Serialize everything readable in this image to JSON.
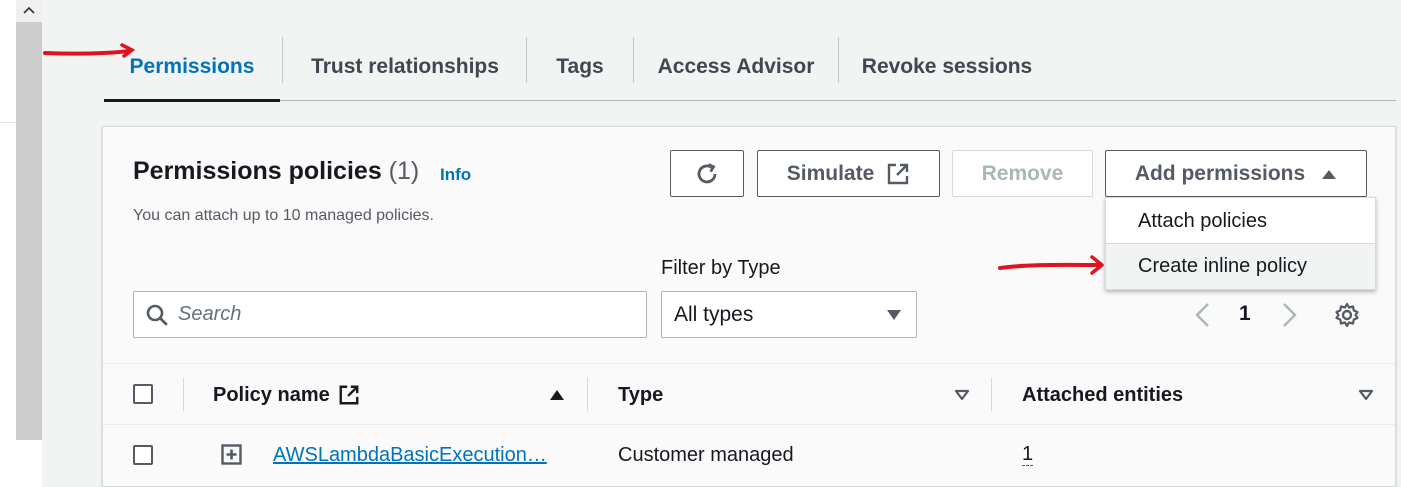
{
  "tabs": [
    {
      "label": "Permissions",
      "active": true
    },
    {
      "label": "Trust relationships",
      "active": false
    },
    {
      "label": "Tags",
      "active": false
    },
    {
      "label": "Access Advisor",
      "active": false
    },
    {
      "label": "Revoke sessions",
      "active": false
    }
  ],
  "panel": {
    "title": "Permissions policies",
    "count": "(1)",
    "info_label": "Info",
    "description": "You can attach up to 10 managed policies."
  },
  "toolbar": {
    "refresh_icon": "refresh-icon",
    "simulate_label": "Simulate",
    "simulate_icon": "external-link-icon",
    "remove_label": "Remove",
    "add_permissions_label": "Add permissions",
    "add_permissions_icon": "caret-up-icon"
  },
  "menu": {
    "items": [
      {
        "label": "Attach policies"
      },
      {
        "label": "Create inline policy"
      }
    ]
  },
  "filters": {
    "search_placeholder": "Search",
    "search_value": "",
    "type_label": "Filter by Type",
    "type_selected": "All types"
  },
  "pagination": {
    "current_page": "1"
  },
  "table": {
    "columns": [
      {
        "label": "Policy name",
        "sort": "ascending"
      },
      {
        "label": "Type",
        "sort": "none"
      },
      {
        "label": "Attached entities",
        "sort": "none"
      }
    ],
    "rows": [
      {
        "policy_name": "AWSLambdaBasicExecution…",
        "type": "Customer managed",
        "attached_entities": "1"
      }
    ]
  },
  "colors": {
    "accent_link": "#0073bb",
    "annotation_red": "#e0141e",
    "text_primary": "#16191f"
  }
}
